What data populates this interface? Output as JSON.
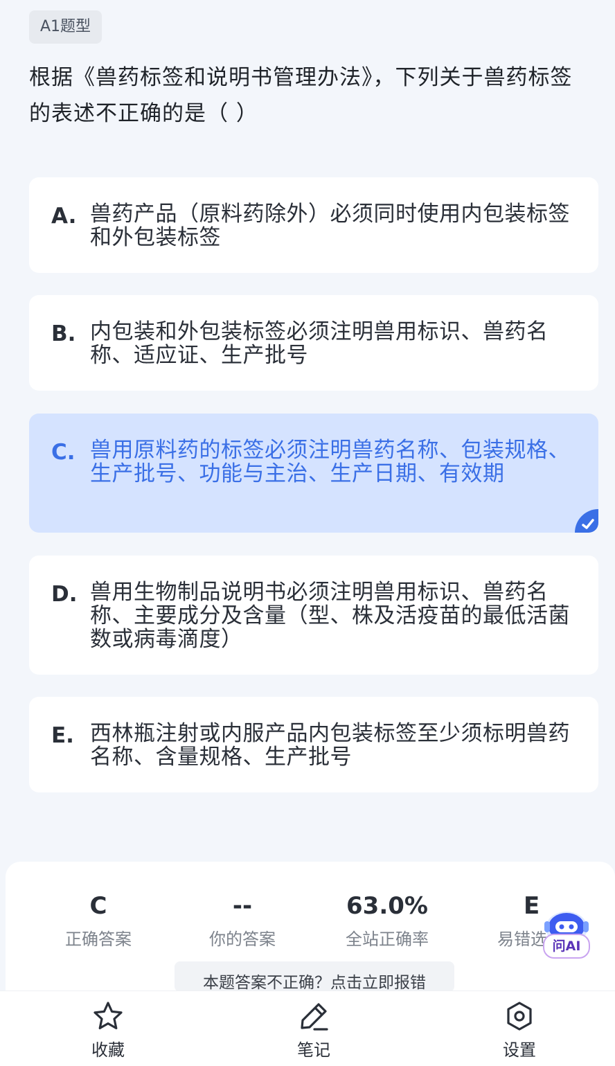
{
  "question": {
    "type_tag": "A1题型",
    "stem": "根据《兽药标签和说明书管理办法》，下列关于兽药标签的表述不正确的是（ ）"
  },
  "options": [
    {
      "letter": "A.",
      "text": "兽药产品（原料药除外）必须同时使用内包装标签和外包装标签",
      "selected": false
    },
    {
      "letter": "B.",
      "text": "内包装和外包装标签必须注明兽用标识、兽药名称、适应证、生产批号",
      "selected": false
    },
    {
      "letter": "C.",
      "text": "兽用原料药的标签必须注明兽药名称、包装规格、生产批号、功能与主治、生产日期、有效期",
      "selected": true
    },
    {
      "letter": "D.",
      "text": "兽用生物制品说明书必须注明兽用标识、兽药名称、主要成分及含量（型、株及活疫苗的最低活菌数或病毒滴度）",
      "selected": false
    },
    {
      "letter": "E.",
      "text": "西林瓶注射或内服产品内包装标签至少须标明兽药名称、含量规格、生产批号",
      "selected": false
    }
  ],
  "stats": {
    "correct_answer": {
      "value": "C",
      "label": "正确答案"
    },
    "your_answer": {
      "value": "--",
      "label": "你的答案"
    },
    "accuracy": {
      "value": "63.0%",
      "label": "全站正确率"
    },
    "common_wrong": {
      "value": "E",
      "label": "易错选"
    }
  },
  "report_text": "本题答案不正确？点击立即报错",
  "ai_button": {
    "label": "问AI"
  },
  "bottom_nav": {
    "favorite": "收藏",
    "notes": "笔记",
    "settings": "设置"
  },
  "colors": {
    "accent": "#3a6fe6",
    "selected_bg": "#d5e3ff",
    "page_bg": "#f3f6fb"
  },
  "icons": {
    "favorite": "star-icon",
    "notes": "pen-icon",
    "settings": "hexagon-gear-icon",
    "selected": "check-icon",
    "ai": "robot-icon"
  }
}
